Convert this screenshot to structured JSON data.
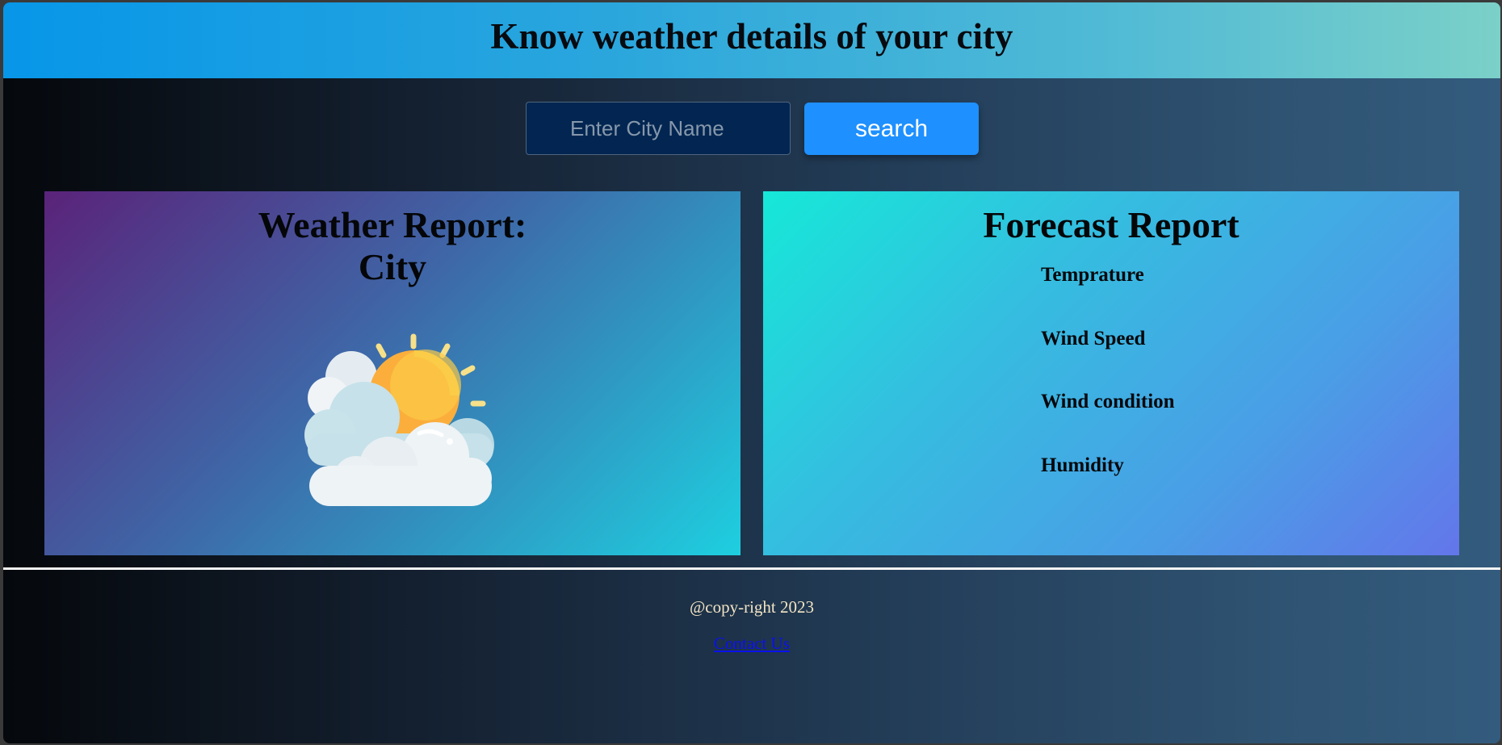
{
  "header": {
    "title": "Know weather details of your city"
  },
  "search": {
    "placeholder": "Enter City Name",
    "value": "",
    "button_label": "search"
  },
  "weather_card": {
    "title_line1": "Weather Report:",
    "title_line2": "City",
    "icon": "partly-cloudy-icon"
  },
  "forecast_card": {
    "title": "Forecast Report",
    "items": [
      {
        "label": "Temprature"
      },
      {
        "label": "Wind Speed"
      },
      {
        "label": "Wind condition"
      },
      {
        "label": "Humidity"
      }
    ]
  },
  "footer": {
    "copyright": "@copy-right 2023",
    "contact_link": "Contact Us"
  },
  "colors": {
    "search_button": "#1e90ff",
    "header_start": "#0796e8",
    "header_end": "#7bd0c8",
    "contact_link": "#0a10ee",
    "copyright_text": "#f2e4c4"
  }
}
